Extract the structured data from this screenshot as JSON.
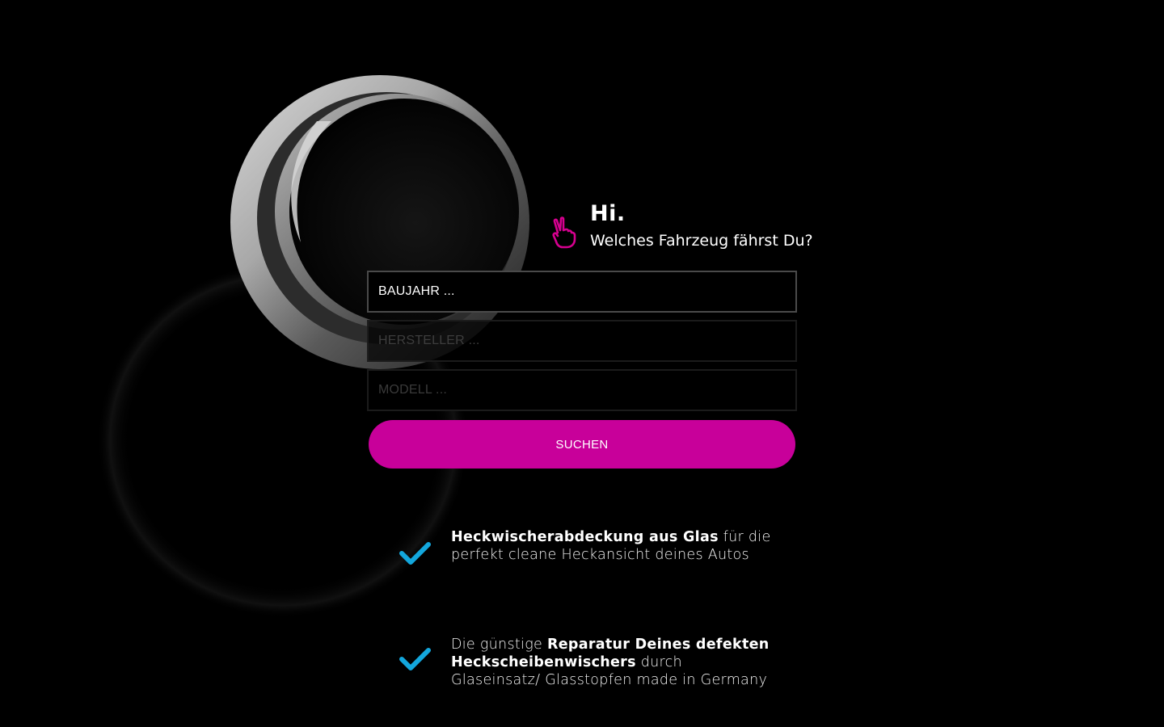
{
  "greeting": {
    "title": "Hi.",
    "subtitle": "Welches Fahrzeug fährst Du?",
    "icon": "peace-hand-icon",
    "icon_color": "#d6008f"
  },
  "form": {
    "fields": [
      {
        "placeholder": "BAUJAHR ...",
        "state": "active"
      },
      {
        "placeholder": "HERSTELLER ...",
        "state": "disabled"
      },
      {
        "placeholder": "MODELL ...",
        "state": "disabled"
      }
    ],
    "search_button": {
      "label": "SUCHEN",
      "color": "#c8009a"
    }
  },
  "features": [
    {
      "icon": "check-icon",
      "icon_color": "#13a7dd",
      "bold_lead": "Heckwischerabdeckung aus Glas",
      "after": " für die perfekt cleane Heckansicht deines Autos"
    },
    {
      "icon": "check-icon",
      "icon_color": "#13a7dd",
      "before": "Die günstige ",
      "bold_mid": "Reparatur Deines defekten Heckscheibenwischers",
      "after": " durch Glaseinsatz/ Glasstopfen made in Germany"
    }
  ],
  "colors": {
    "background": "#000000",
    "accent": "#c8009a",
    "check": "#13a7dd"
  }
}
